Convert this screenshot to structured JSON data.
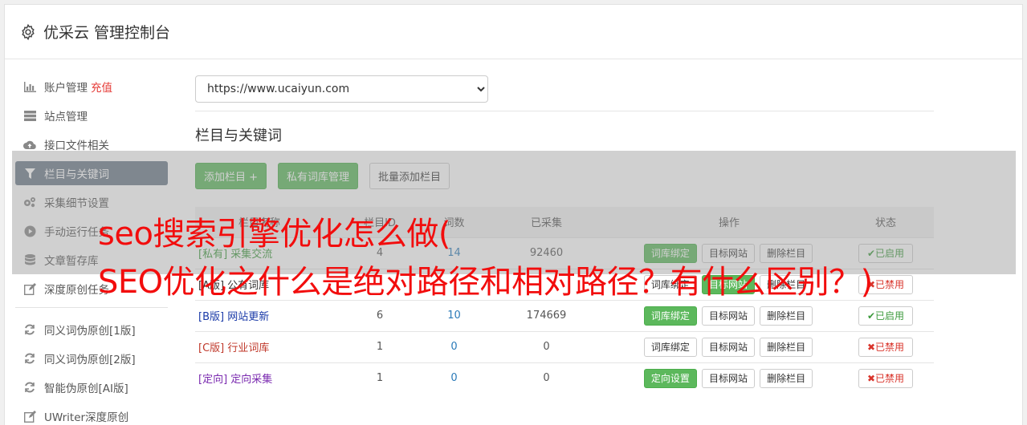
{
  "header": {
    "title": "优采云 管理控制台",
    "icon": "gear-icon"
  },
  "sidebar": {
    "items": [
      {
        "label": "账户管理",
        "extra": "充值",
        "icon": "bar-chart-icon"
      },
      {
        "label": "站点管理",
        "icon": "server-icon"
      },
      {
        "label": "接口文件相关",
        "icon": "cloud-upload-icon"
      },
      {
        "label": "栏目与关键词",
        "icon": "filter-icon",
        "active": true
      },
      {
        "label": "采集细节设置",
        "icon": "cogs-icon"
      },
      {
        "label": "手动运行任务",
        "icon": "play-circle-icon"
      },
      {
        "label": "文章暂存库",
        "icon": "database-icon"
      },
      {
        "label": "深度原创任务",
        "icon": "edit-icon"
      }
    ],
    "items2": [
      {
        "label": "同义词伪原创[1版]",
        "icon": "refresh-icon"
      },
      {
        "label": "同义词伪原创[2版]",
        "icon": "refresh-icon"
      },
      {
        "label": "智能伪原创[AI版]",
        "icon": "refresh-icon"
      },
      {
        "label": "UWriter深度原创",
        "icon": "edit-icon"
      }
    ]
  },
  "main": {
    "site_select": "https://www.ucaiyun.com",
    "section_title": "栏目与关键词",
    "buttons": {
      "add": "添加栏目 +",
      "private": "私有词库管理",
      "batch": "批量添加栏目"
    },
    "table": {
      "headers": [
        "栏目名称",
        "栏目ID",
        "词数",
        "已采集",
        "操作",
        "状态"
      ],
      "rows": [
        {
          "name": "[私有] 采集交流",
          "id": "4",
          "words": "14",
          "collected": "92460",
          "op1": "词库绑定",
          "op2": "目标网站",
          "op3": "删除栏目",
          "status": "✔已启用"
        },
        {
          "name": "[A版] 公有词库",
          "id": "",
          "words": "",
          "collected": "",
          "op1": "词库绑定",
          "op2": "目标网站",
          "op3": "删除栏目",
          "status": "✖已禁用"
        },
        {
          "name": "[B版] 网站更新",
          "id": "6",
          "words": "10",
          "collected": "174669",
          "op1": "词库绑定",
          "op2": "目标网站",
          "op3": "删除栏目",
          "status": "✔已启用"
        },
        {
          "name": "[C版] 行业词库",
          "id": "1",
          "words": "0",
          "collected": "0",
          "op1": "词库绑定",
          "op2": "目标网站",
          "op3": "删除栏目",
          "status": "✖已禁用"
        },
        {
          "name": "[定向] 定向采集",
          "id": "1",
          "words": "0",
          "collected": "0",
          "op1": "定向设置",
          "op2": "目标网站",
          "op3": "删除栏目",
          "status": "✖已禁用"
        }
      ]
    }
  },
  "overlay": {
    "line1": "seo搜索引擎优化怎么做(",
    "line2": "SEO优化之什么是绝对路径和相对路径？有什么区别？)"
  },
  "colors": {
    "accent_green": "#5cb85c",
    "active_nav": "#6c7a89",
    "overlay_text": "#f20d0d"
  }
}
